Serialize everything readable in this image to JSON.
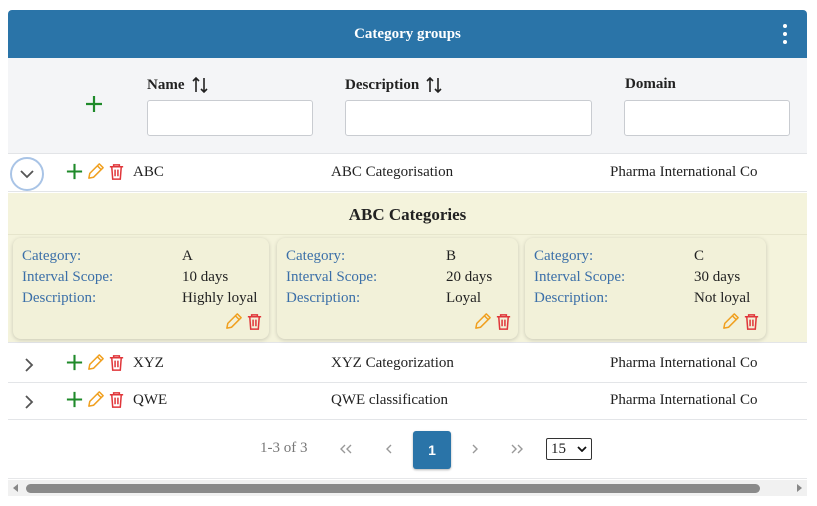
{
  "header": {
    "title": "Category groups",
    "menu_icon": "kebab-menu-icon"
  },
  "columns": {
    "name": "Name",
    "description": "Description",
    "domain": "Domain",
    "sort_icon": "sort-arrows-icon",
    "add_icon": "plus-icon"
  },
  "filters": {
    "name": "",
    "description": "",
    "domain": ""
  },
  "rows": [
    {
      "name": "ABC",
      "description": "ABC Categorisation",
      "domain": "Pharma International Co",
      "expanded": true
    },
    {
      "name": "XYZ",
      "description": "XYZ Categorization",
      "domain": "Pharma International Co",
      "expanded": false
    },
    {
      "name": "QWE",
      "description": "QWE classification",
      "domain": "Pharma International Co",
      "expanded": false
    }
  ],
  "expansion": {
    "title": "ABC Categories",
    "labels": {
      "category": "Category:",
      "interval": "Interval Scope:",
      "description": "Description:"
    },
    "cards": [
      {
        "category": "A",
        "interval": "10 days",
        "description": "Highly loyal"
      },
      {
        "category": "B",
        "interval": "20 days",
        "description": "Loyal"
      },
      {
        "category": "C",
        "interval": "30 days",
        "description": "Not loyal"
      }
    ]
  },
  "pagination": {
    "count": "1-3 of 3",
    "current_page": "1",
    "page_size": "15",
    "first_label": "«",
    "prev_label": "‹",
    "next_label": "›",
    "last_label": "»"
  },
  "colors": {
    "header": "#2a74a8",
    "add": "#1f8a2a",
    "edit": "#f0a020",
    "delete": "#e0363a",
    "label_blue": "#3b6fa8",
    "expansion_bg": "#f4f3dc"
  }
}
